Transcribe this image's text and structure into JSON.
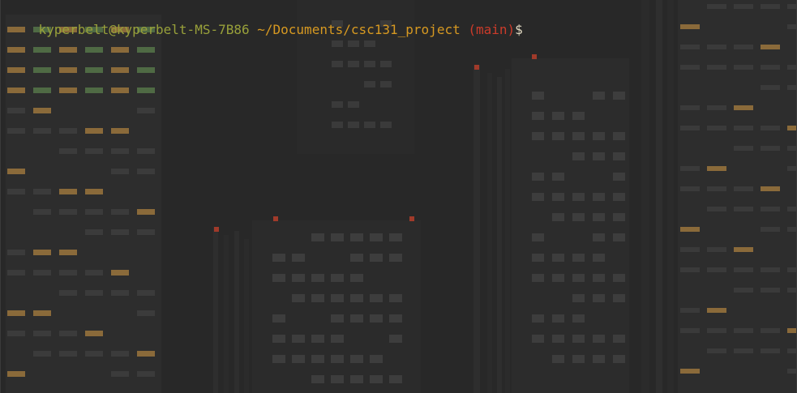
{
  "terminal": {
    "prompt": {
      "user_host": "kyperbelt@kyperbelt-MS-7B86",
      "path": " ~/Documents/csc131_project ",
      "branch": "(main)",
      "symbol": "$"
    }
  },
  "colors": {
    "background": "#282828",
    "user_host": "#98a03a",
    "path": "#d79921",
    "branch": "#cc3b2a",
    "symbol": "#e0d8c0",
    "building": "#2d2d2d",
    "window_lit": "#4a4a4a",
    "window_warm": "#8a6a3a",
    "window_green": "#4f6a44",
    "beacon": "#a03a2a"
  },
  "wallpaper": {
    "icon": "pixel-city-skyline-wallpaper"
  }
}
